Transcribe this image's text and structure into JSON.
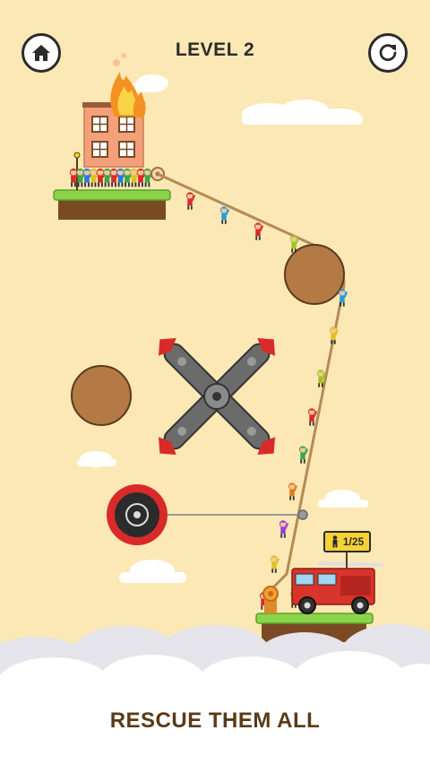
{
  "header": {
    "level_title": "LEVEL 2"
  },
  "counter": {
    "text": "1/25",
    "rescued": 1,
    "total": 25
  },
  "tagline": "RESCUE THEM ALL",
  "icons": {
    "home": "home-icon",
    "restart": "restart-icon",
    "person": "person-icon",
    "gear": "gear-icon"
  },
  "colors": {
    "background": "#fbe8b4",
    "grass": "#8bd44a",
    "dirt": "#7a4a25",
    "rope": "#b58a55",
    "wood_ball": "#b37a45",
    "saw_red": "#d92a2a",
    "truck_red": "#d9342b",
    "badge": "#f6d335"
  }
}
